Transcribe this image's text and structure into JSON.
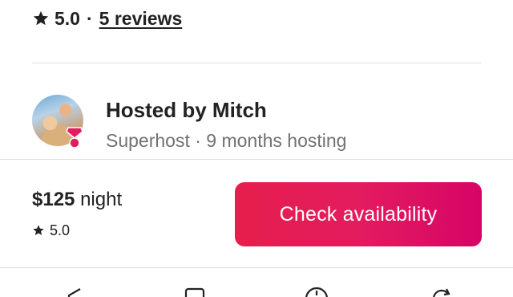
{
  "rating": {
    "value": "5.0",
    "separator": "·",
    "reviews_link": "5 reviews",
    "icon": "star-icon"
  },
  "host": {
    "title": "Hosted by Mitch",
    "subtitle": "Superhost · 9 months hosting",
    "avatar_icon": "host-avatar",
    "badge_icon": "superhost-badge-icon"
  },
  "footer": {
    "price": "$125",
    "price_unit": "night",
    "mini_rating": "5.0",
    "cta_label": "Check availability"
  },
  "bottom_nav": {
    "icons": [
      "share-arrow-icon",
      "bookmark-icon",
      "compass-icon",
      "refresh-icon"
    ]
  },
  "colors": {
    "accent_start": "#e61e4d",
    "accent_end": "#d70466",
    "text_primary": "#222222",
    "text_secondary": "#717171",
    "divider": "#dddddd"
  }
}
